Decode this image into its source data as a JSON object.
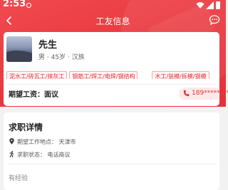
{
  "status_bar": {
    "time": "2:53",
    "icons": [
      "notification-dot-icon",
      "wifi-icon",
      "signal-icon",
      "battery-icon"
    ]
  },
  "navbar": {
    "title": "工友信息",
    "back_icon": "chevron-left-icon",
    "message_icon": "chat-bubble-icon"
  },
  "profile": {
    "name": "先生",
    "meta": "男 · 45岁 · 汉族",
    "tags": [
      "泥水工/砖瓦工/抹灰工",
      "钢筋工/焊工/电焊/钢结构",
      "木工/装模/拆模/钢模"
    ],
    "salary_label": "期望工资：面议",
    "phone": "189********"
  },
  "job_detail": {
    "title": "求职详情",
    "location": "期望工作地点：  天津市",
    "status": "求职状态：  电话商议",
    "experience": "有经验"
  },
  "colors": {
    "brand_red": "#e53238",
    "tag_border": "#f2a8aa",
    "phone_bg": "#fde9e9"
  }
}
